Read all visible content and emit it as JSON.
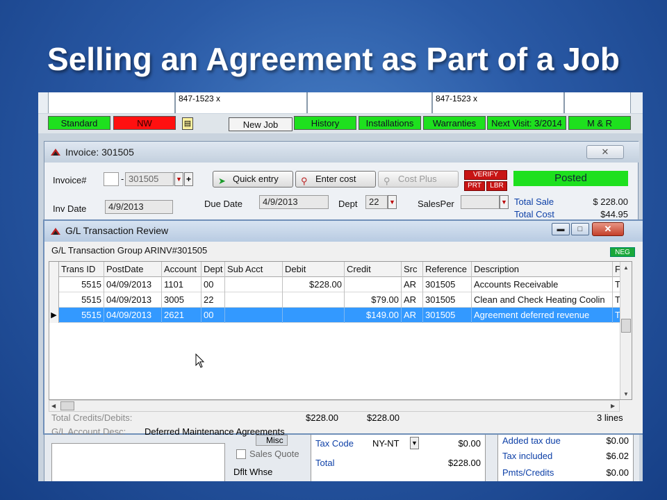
{
  "slide": {
    "title": "Selling an Agreement  as Part of a Job"
  },
  "topform": {
    "phone1": "847-1523 x",
    "phone2": "847-1523 x"
  },
  "tabs": {
    "standard": "Standard",
    "nw": "NW",
    "new_job": "New Job",
    "history": "History",
    "installations": "Installations",
    "warranties": "Warranties",
    "next_visit": "Next Visit: 3/2014",
    "mr": "M & R"
  },
  "invoice": {
    "title": "Invoice: 301505",
    "invoice_label": "Invoice#",
    "invoice_prefix": "",
    "invoice_number": "301505",
    "inv_date_label": "Inv Date",
    "inv_date": "4/9/2013",
    "due_date_label": "Due Date",
    "due_date": "4/9/2013",
    "dept_label": "Dept",
    "dept": "22",
    "salesper_label": "SalesPer",
    "salesper": "",
    "quick_entry": "Quick entry",
    "enter_cost": "Enter cost",
    "cost_plus": "Cost Plus",
    "verify": "VERIFY",
    "prt": "PRT",
    "lbr": "LBR",
    "status": "Posted",
    "total_sale_label": "Total Sale",
    "total_sale": "$ 228.00",
    "total_cost_label": "Total Cost",
    "total_cost": "$44.95"
  },
  "gl": {
    "title": "G/L Transaction Review",
    "group": "G/L Transaction Group ARINV#301505",
    "neg": "NEG",
    "columns": [
      "Trans ID",
      "PostDate",
      "Account",
      "Dept",
      "Sub Acct",
      "Debit",
      "Credit",
      "Src",
      "Reference",
      "Description",
      "F"
    ],
    "rows": [
      [
        "5515",
        "04/09/2013",
        "1101",
        "00",
        "",
        "$228.00",
        "",
        "AR",
        "301505",
        "Accounts Receivable",
        "T"
      ],
      [
        "5515",
        "04/09/2013",
        "3005",
        "22",
        "",
        "",
        "$79.00",
        "AR",
        "301505",
        "Clean and Check Heating Coolin",
        "T"
      ],
      [
        "5515",
        "04/09/2013",
        "2621",
        "00",
        "",
        "",
        "$149.00",
        "AR",
        "301505",
        "Agreement deferred revenue",
        "T"
      ]
    ],
    "selected_row": 2,
    "totals_label": "Total Credits/Debits:",
    "total_debits": "$228.00",
    "total_credits": "$228.00",
    "line_count": "3  lines",
    "acct_desc_label": "G/L Account Desc:",
    "acct_desc": "Deferred Maintenance Agreements"
  },
  "lower": {
    "misc": "Misc",
    "sales_quote": "Sales Quote",
    "dflt_whse": "Dflt Whse",
    "tax_code_label": "Tax Code",
    "tax_code": "NY-NT",
    "tax_amt": "$0.00",
    "total_label": "Total",
    "total": "$228.00",
    "added_tax_label": "Added tax due",
    "added_tax": "$0.00",
    "tax_included_label": "Tax included",
    "tax_included": "$6.02",
    "pmts_label": "Pmts/Credits",
    "pmts": "$0.00"
  }
}
